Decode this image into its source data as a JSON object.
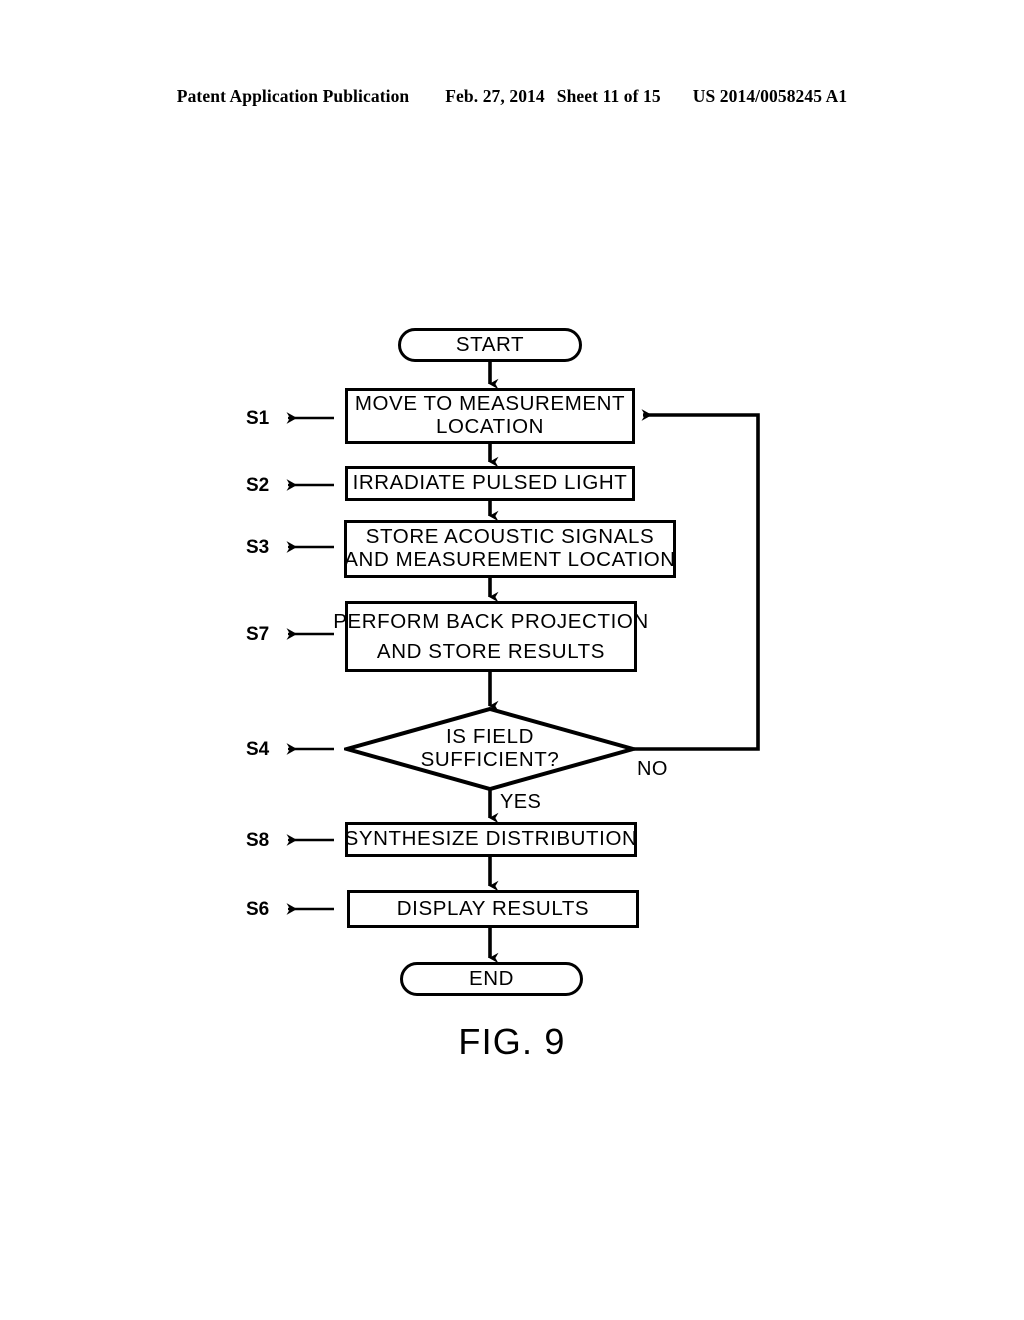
{
  "header": {
    "publication": "Patent Application Publication",
    "date": "Feb. 27, 2014",
    "sheet": "Sheet 11 of 15",
    "number": "US 2014/0058245 A1"
  },
  "figure": {
    "caption": "FIG. 9",
    "start_label": "START",
    "end_label": "END",
    "branch_yes": "YES",
    "branch_no": "NO",
    "steps": [
      {
        "id": "S1",
        "line1": "MOVE TO  MEASUREMENT",
        "line2": "LOCATION"
      },
      {
        "id": "S2",
        "line1": "IRRADIATE PULSED LIGHT",
        "line2": ""
      },
      {
        "id": "S3",
        "line1": "STORE  ACOUSTIC  SIGNALS",
        "line2": "AND  MEASUREMENT  LOCATION"
      },
      {
        "id": "S7",
        "line1": "PERFORM  BACK  PROJECTION",
        "line2": "AND STORE RESULTS"
      },
      {
        "id": "S4",
        "line1": "IS  FIELD",
        "line2": "SUFFICIENT?"
      },
      {
        "id": "S8",
        "line1": "SYNTHESIZE  DISTRIBUTION",
        "line2": ""
      },
      {
        "id": "S6",
        "line1": "DISPLAY RESULTS",
        "line2": ""
      }
    ]
  },
  "colors": {
    "ink": "#000000",
    "paper": "#ffffff"
  }
}
